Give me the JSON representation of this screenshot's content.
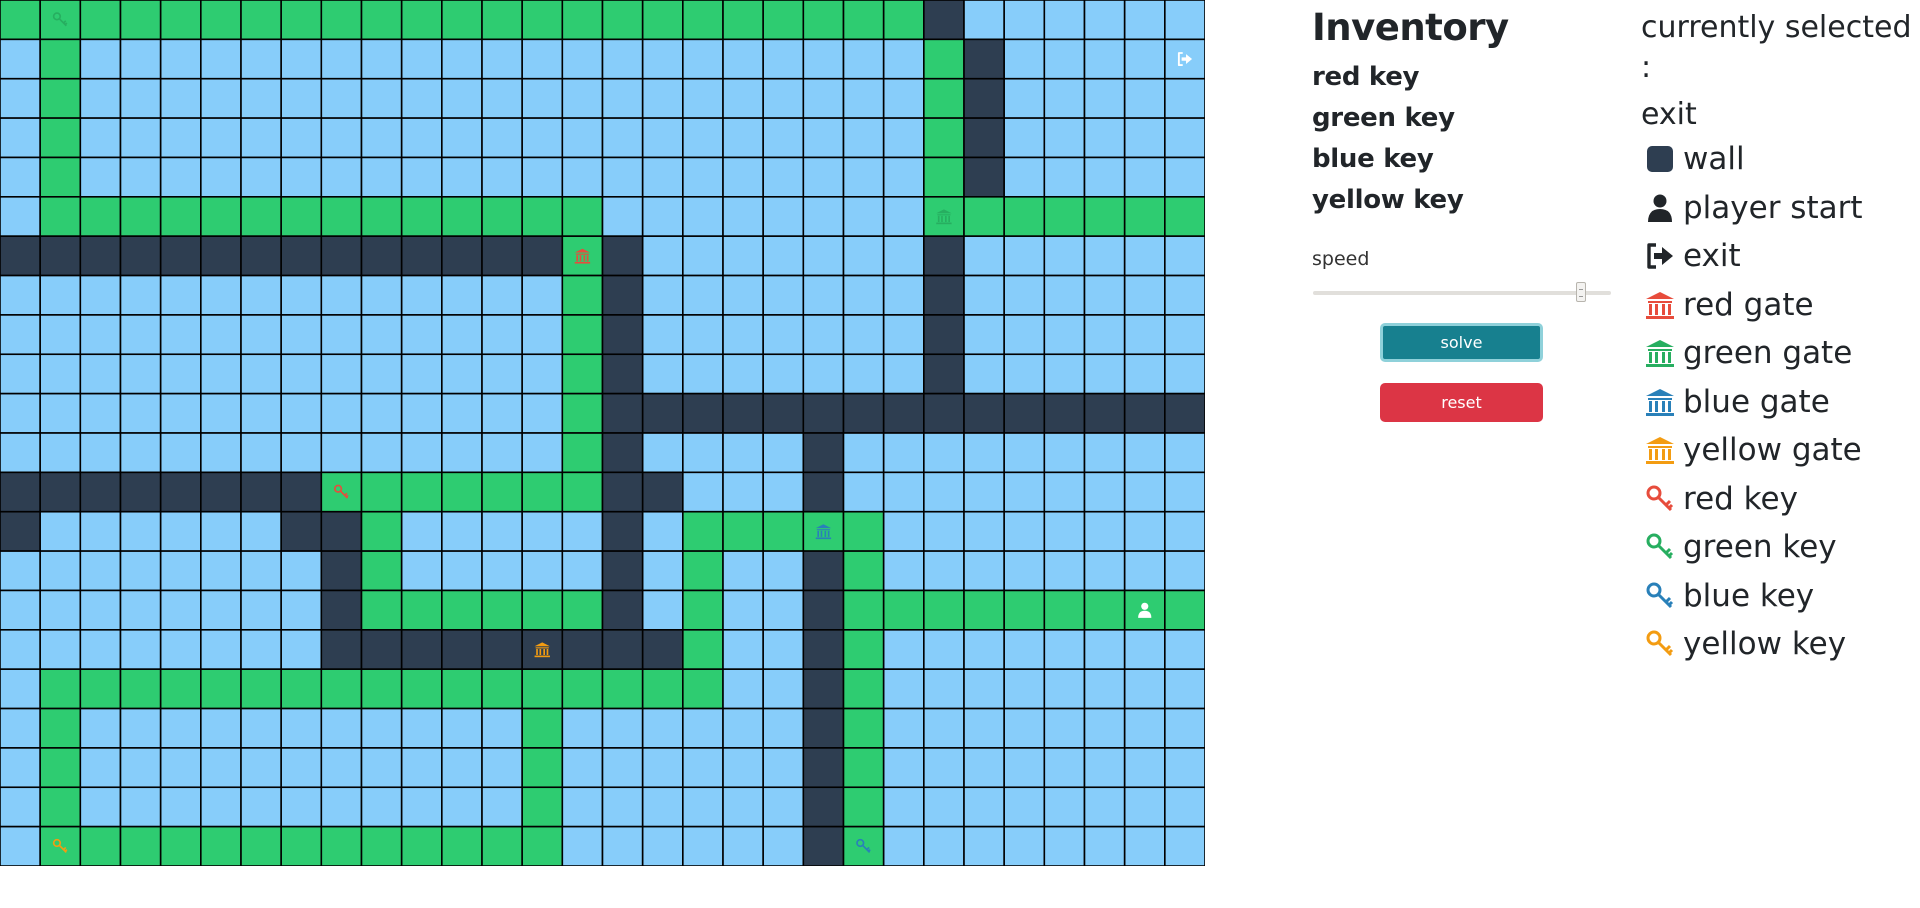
{
  "colors": {
    "floor": "#87cdfa",
    "wall": "#2e3e51",
    "path": "#2ecc71",
    "red": "#e74c3c",
    "green": "#27ae60",
    "blue": "#2980b9",
    "yellow": "#f39c12",
    "white": "#ffffff"
  },
  "maze": {
    "cols": 30,
    "rows": 22,
    "rows_map": [
      "PPPPPPPPPPPPPPPPPPPPPPPW......",
      ".P.....................PW.....P",
      ".P.....................PW.....P",
      ".P.....................PW.....P",
      ".P.....................PW.....P",
      ".PPPPPPPPPPPPPP........PPPPPPP",
      "WWWWWWWWWWWWWWPW.......W......",
      "..............PW.......W......",
      "..............PW.......W......",
      "..............PW.......W......",
      "..............PWWWWWWWWWWWWWWW",
      "..............PW....W.........",
      "WWWWWWWWPPPPPPPWW...W.........",
      "W......WWP.....W.PPPPP........",
      "........WP.....W.P..WP........",
      "........WPPPPPPW.P..WPPPPPPPPP.",
      "........WWWWWWWWWP..WP........",
      ".PPPPPPPPPPPPPPPPP..WP........",
      ".P...........P......WP........",
      ".P...........P......WP........",
      ".P...........P......WP........",
      ".PPPPPPPPPPPPP......WP........"
    ],
    "items": [
      {
        "row": 0,
        "col": 1,
        "type": "key",
        "color": "green",
        "name": "green-key"
      },
      {
        "row": 1,
        "col": 29,
        "type": "exit",
        "color": "white",
        "name": "exit"
      },
      {
        "row": 5,
        "col": 23,
        "type": "gate",
        "color": "green",
        "name": "green-gate"
      },
      {
        "row": 6,
        "col": 14,
        "type": "gate",
        "color": "red",
        "name": "red-gate"
      },
      {
        "row": 12,
        "col": 8,
        "type": "key",
        "color": "red",
        "name": "red-key"
      },
      {
        "row": 13,
        "col": 20,
        "type": "gate",
        "color": "blue",
        "name": "blue-gate"
      },
      {
        "row": 15,
        "col": 28,
        "type": "player",
        "color": "white",
        "name": "player-start"
      },
      {
        "row": 16,
        "col": 13,
        "type": "gate",
        "color": "yellow",
        "name": "yellow-gate"
      },
      {
        "row": 21,
        "col": 1,
        "type": "key",
        "color": "yellow",
        "name": "yellow-key"
      },
      {
        "row": 21,
        "col": 21,
        "type": "key",
        "color": "blue",
        "name": "blue-key"
      }
    ]
  },
  "inventory": {
    "title": "Inventory",
    "items": [
      "red key",
      "green key",
      "blue key",
      "yellow key"
    ]
  },
  "controls": {
    "speed_label": "speed",
    "speed_level": 0.9,
    "solve_label": "solve",
    "reset_label": "reset"
  },
  "palette": {
    "selected_title": "currently selected :",
    "selected_value": "exit",
    "items": [
      {
        "label": "wall",
        "icon": "wall-icon",
        "color": "#2e3e51"
      },
      {
        "label": "player start",
        "icon": "user-icon",
        "color": "#212529"
      },
      {
        "label": "exit",
        "icon": "exit-icon",
        "color": "#212529"
      },
      {
        "label": "red gate",
        "icon": "gate-icon",
        "color": "#e74c3c"
      },
      {
        "label": "green gate",
        "icon": "gate-icon",
        "color": "#27ae60"
      },
      {
        "label": "blue gate",
        "icon": "gate-icon",
        "color": "#2980b9"
      },
      {
        "label": "yellow gate",
        "icon": "gate-icon",
        "color": "#f39c12"
      },
      {
        "label": "red key",
        "icon": "key-icon",
        "color": "#e74c3c"
      },
      {
        "label": "green key",
        "icon": "key-icon",
        "color": "#27ae60"
      },
      {
        "label": "blue key",
        "icon": "key-icon",
        "color": "#2980b9"
      },
      {
        "label": "yellow key",
        "icon": "key-icon",
        "color": "#f39c12"
      }
    ]
  }
}
